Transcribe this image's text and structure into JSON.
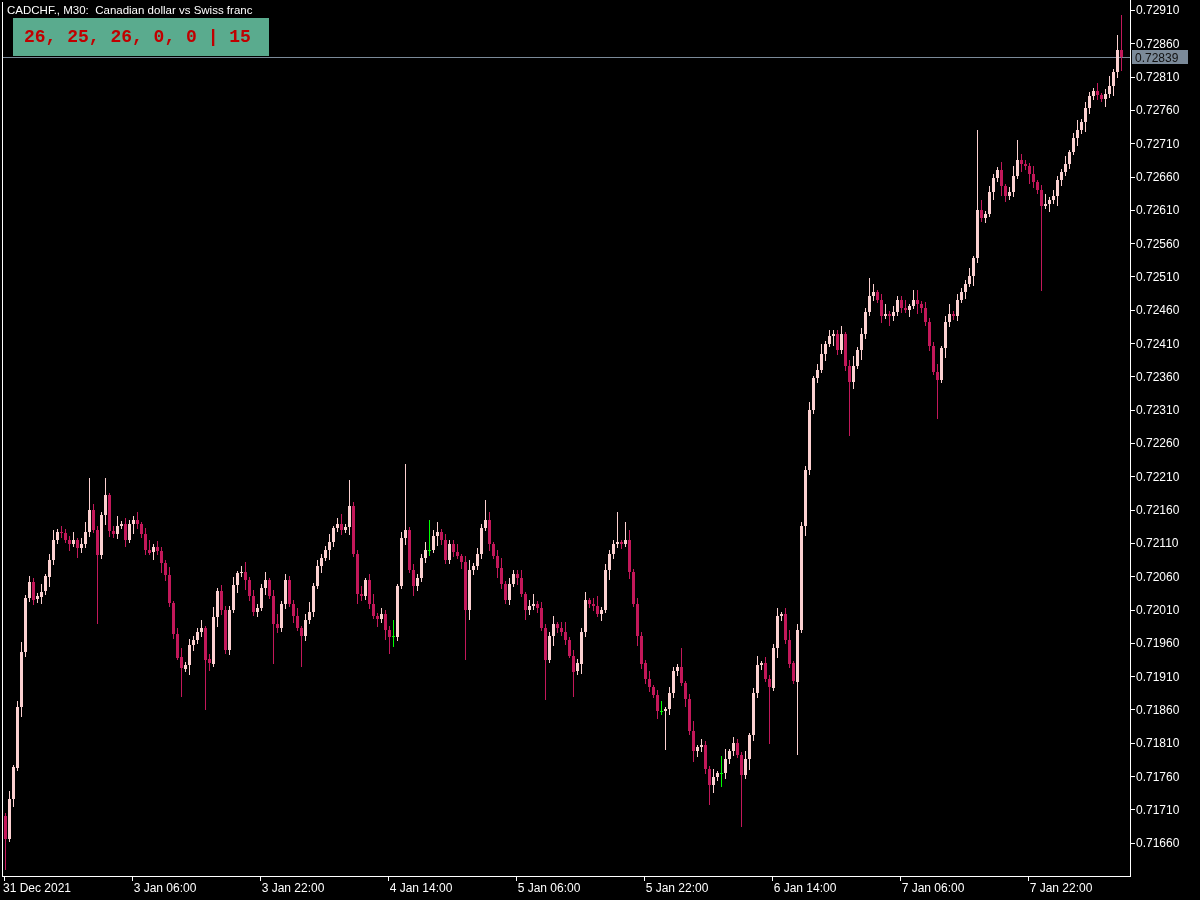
{
  "chart": {
    "chart_data": {
      "type": "candlestick",
      "title": "CADCHF., M30:  Canadian dollar vs Swiss franc",
      "categories": [
        null,
        null,
        null,
        null,
        null,
        null,
        null,
        null,
        "31 Dec 2021",
        null,
        null,
        null,
        null,
        null,
        null,
        null,
        null,
        null,
        null,
        null,
        null,
        null,
        null,
        null,
        null,
        null,
        null,
        null,
        null,
        null,
        null,
        null,
        null,
        null,
        null,
        null,
        null,
        null,
        null,
        null,
        "3 Jan 06:00",
        null,
        null,
        null,
        null,
        null,
        null,
        null,
        null,
        null,
        null,
        null,
        null,
        null,
        null,
        null,
        null,
        null,
        null,
        null,
        null,
        null,
        null,
        null,
        null,
        null,
        null,
        null,
        null,
        null,
        null,
        null,
        "3 Jan 22:00",
        null,
        null,
        null,
        null,
        null,
        null,
        null,
        null,
        null,
        null,
        null,
        null,
        null,
        null,
        null,
        null,
        null,
        null,
        null,
        null,
        null,
        null,
        null,
        null,
        null,
        null,
        null,
        null,
        null,
        null,
        null,
        "4 Jan 14:00",
        null,
        null,
        null,
        null,
        null,
        null,
        null,
        null,
        null,
        null,
        null,
        null,
        null,
        null,
        null,
        null,
        null,
        null,
        null,
        null,
        null,
        null,
        null,
        null,
        null,
        null,
        null,
        null,
        null,
        null,
        null,
        "5 Jan 06:00",
        null,
        null,
        null,
        null,
        null,
        null,
        null,
        null,
        null,
        null,
        null,
        null,
        null,
        null,
        null,
        null,
        null,
        null,
        null,
        null,
        null,
        null,
        null,
        null,
        null,
        null,
        null,
        null,
        null,
        null,
        null,
        "5 Jan 22:00",
        null,
        null,
        null,
        null,
        null,
        null,
        null,
        null,
        null,
        null,
        null,
        null,
        null,
        null,
        null,
        null,
        null,
        null,
        null,
        null,
        null,
        null,
        null,
        null,
        null,
        null,
        null,
        null,
        null,
        null,
        null,
        "6 Jan 14:00",
        null,
        null,
        null,
        null,
        null,
        null,
        null,
        null,
        null,
        null,
        null,
        null,
        null,
        null,
        null,
        null,
        null,
        null,
        null,
        null,
        null,
        null,
        null,
        null,
        null,
        null,
        null,
        null,
        null,
        null,
        null,
        "7 Jan 06:00",
        null,
        null,
        null,
        null,
        null,
        null,
        null,
        null,
        null,
        null,
        null,
        null,
        null,
        null,
        null,
        null,
        null,
        null,
        null,
        null,
        null,
        null,
        null,
        null,
        null,
        null,
        null,
        null,
        null,
        null,
        null,
        "7 Jan 22:00",
        null,
        null,
        null,
        null,
        null,
        null,
        null,
        null,
        null,
        null,
        null,
        null,
        null,
        null,
        null
      ],
      "ohlc": [
        [
          0.717,
          0.71705,
          0.7162,
          0.71665
        ],
        [
          0.71665,
          0.71737,
          0.71662,
          0.71725
        ],
        [
          0.71725,
          0.71776,
          0.71715,
          0.71773
        ],
        [
          0.71773,
          0.71872,
          0.71769,
          0.71864
        ],
        [
          0.71864,
          0.71962,
          0.7185,
          0.71947
        ],
        [
          0.71947,
          0.72032,
          0.7194,
          0.72028
        ],
        [
          0.72028,
          0.72061,
          0.72023,
          0.72052
        ],
        [
          0.72052,
          0.72058,
          0.72019,
          0.72025
        ],
        [
          0.72025,
          0.72035,
          0.72022,
          0.7203
        ],
        [
          0.7203,
          0.72049,
          0.7202,
          0.72037
        ],
        [
          0.72037,
          0.72063,
          0.72033,
          0.7206
        ],
        [
          0.7206,
          0.72093,
          0.72046,
          0.72085
        ],
        [
          0.72085,
          0.7213,
          0.72078,
          0.72115
        ],
        [
          0.72115,
          0.72131,
          0.7211,
          0.72127
        ],
        [
          0.72127,
          0.72136,
          0.72119,
          0.72125
        ],
        [
          0.72125,
          0.72131,
          0.72112,
          0.72115
        ],
        [
          0.72115,
          0.7212,
          0.72099,
          0.72109
        ],
        [
          0.72109,
          0.72127,
          0.72105,
          0.72115
        ],
        [
          0.72115,
          0.72118,
          0.72089,
          0.72103
        ],
        [
          0.72103,
          0.72117,
          0.72096,
          0.72109
        ],
        [
          0.72109,
          0.72142,
          0.72104,
          0.72127
        ],
        [
          0.72127,
          0.72208,
          0.72121,
          0.7216
        ],
        [
          0.7216,
          0.72169,
          0.72127,
          0.7213
        ],
        [
          0.7213,
          0.72136,
          0.7199,
          0.72092
        ],
        [
          0.72092,
          0.72157,
          0.72088,
          0.72152
        ],
        [
          0.72152,
          0.72208,
          0.72138,
          0.72182
        ],
        [
          0.72182,
          0.72185,
          0.72121,
          0.72128
        ],
        [
          0.72128,
          0.72136,
          0.72119,
          0.72124
        ],
        [
          0.72124,
          0.72151,
          0.72118,
          0.72136
        ],
        [
          0.72136,
          0.72143,
          0.72133,
          0.72139
        ],
        [
          0.72139,
          0.72148,
          0.72105,
          0.72115
        ],
        [
          0.72115,
          0.72145,
          0.72111,
          0.72139
        ],
        [
          0.72139,
          0.7215,
          0.72125,
          0.72145
        ],
        [
          0.72145,
          0.72157,
          0.72132,
          0.72139
        ],
        [
          0.72139,
          0.72142,
          0.72119,
          0.72124
        ],
        [
          0.72124,
          0.72132,
          0.72094,
          0.721
        ],
        [
          0.721,
          0.72115,
          0.72093,
          0.72096
        ],
        [
          0.72096,
          0.72108,
          0.72086,
          0.72104
        ],
        [
          0.72104,
          0.72113,
          0.72094,
          0.72098
        ],
        [
          0.72098,
          0.72104,
          0.72066,
          0.7208
        ],
        [
          0.7208,
          0.72085,
          0.72055,
          0.72062
        ],
        [
          0.72062,
          0.72074,
          0.72015,
          0.7202
        ],
        [
          0.7202,
          0.72023,
          0.71968,
          0.71974
        ],
        [
          0.71974,
          0.71982,
          0.71935,
          0.71938
        ],
        [
          0.71938,
          0.71953,
          0.7188,
          0.71921
        ],
        [
          0.71921,
          0.71931,
          0.71917,
          0.71927
        ],
        [
          0.71927,
          0.71966,
          0.71913,
          0.71957
        ],
        [
          0.71957,
          0.71971,
          0.7195,
          0.71965
        ],
        [
          0.71965,
          0.71982,
          0.7196,
          0.71977
        ],
        [
          0.71977,
          0.71995,
          0.71971,
          0.71983
        ],
        [
          0.71983,
          0.71986,
          0.7186,
          0.71935
        ],
        [
          0.71935,
          0.71943,
          0.71919,
          0.71929
        ],
        [
          0.71929,
          0.72014,
          0.71925,
          0.71999
        ],
        [
          0.71999,
          0.72042,
          0.71985,
          0.72038
        ],
        [
          0.72038,
          0.72047,
          0.72003,
          0.7201
        ],
        [
          0.7201,
          0.72016,
          0.71945,
          0.7195
        ],
        [
          0.7195,
          0.72015,
          0.71944,
          0.7201
        ],
        [
          0.7201,
          0.72059,
          0.72007,
          0.72047
        ],
        [
          0.72047,
          0.72068,
          0.72037,
          0.72065
        ],
        [
          0.72065,
          0.72075,
          0.72061,
          0.72067
        ],
        [
          0.72067,
          0.72082,
          0.72041,
          0.72055
        ],
        [
          0.72055,
          0.72059,
          0.72024,
          0.72031
        ],
        [
          0.72031,
          0.7204,
          0.72002,
          0.72007
        ],
        [
          0.72007,
          0.72019,
          0.72001,
          0.72013
        ],
        [
          0.72013,
          0.72048,
          0.7201,
          0.72043
        ],
        [
          0.72043,
          0.72067,
          0.72033,
          0.72055
        ],
        [
          0.72055,
          0.72058,
          0.72027,
          0.72031
        ],
        [
          0.72031,
          0.72039,
          0.7193,
          0.71989
        ],
        [
          0.71989,
          0.72004,
          0.71976,
          0.71983
        ],
        [
          0.71983,
          0.72023,
          0.71978,
          0.72019
        ],
        [
          0.72019,
          0.72064,
          0.72013,
          0.72055
        ],
        [
          0.72055,
          0.72061,
          0.72016,
          0.72019
        ],
        [
          0.72019,
          0.72024,
          0.71991,
          0.72001
        ],
        [
          0.72001,
          0.72013,
          0.71979,
          0.71983
        ],
        [
          0.71983,
          0.71986,
          0.71925,
          0.71971
        ],
        [
          0.71971,
          0.72003,
          0.71964,
          0.71995
        ],
        [
          0.71995,
          0.72022,
          0.7199,
          0.72007
        ],
        [
          0.72007,
          0.7205,
          0.72001,
          0.72046
        ],
        [
          0.72046,
          0.72085,
          0.72043,
          0.72076
        ],
        [
          0.72076,
          0.72094,
          0.72066,
          0.72088
        ],
        [
          0.72088,
          0.72105,
          0.72084,
          0.721
        ],
        [
          0.721,
          0.72124,
          0.72086,
          0.72112
        ],
        [
          0.72112,
          0.72136,
          0.72105,
          0.72133
        ],
        [
          0.72133,
          0.72147,
          0.72128,
          0.72139
        ],
        [
          0.72139,
          0.72154,
          0.72124,
          0.7213
        ],
        [
          0.7213,
          0.72138,
          0.72127,
          0.72134
        ],
        [
          0.72134,
          0.72205,
          0.72124,
          0.72166
        ],
        [
          0.72166,
          0.72172,
          0.7209,
          0.72094
        ],
        [
          0.72094,
          0.72099,
          0.7202,
          0.72034
        ],
        [
          0.72034,
          0.72046,
          0.72024,
          0.72031
        ],
        [
          0.72031,
          0.72058,
          0.72026,
          0.72055
        ],
        [
          0.72055,
          0.72063,
          0.72013,
          0.72019
        ],
        [
          0.72019,
          0.72034,
          0.71998,
          0.72001
        ],
        [
          0.72001,
          0.72005,
          0.71986,
          0.71996
        ],
        [
          0.71996,
          0.72013,
          0.71992,
          0.72004
        ],
        [
          0.72004,
          0.7201,
          0.71966,
          0.7198
        ],
        [
          0.7198,
          0.71985,
          0.71945,
          0.7197
        ],
        [
          0.7197,
          0.71995,
          0.71955,
          0.7197
        ],
        [
          0.7197,
          0.72049,
          0.71964,
          0.72046
        ],
        [
          0.72046,
          0.72126,
          0.72043,
          0.72118
        ],
        [
          0.72118,
          0.72228,
          0.72108,
          0.7213
        ],
        [
          0.7213,
          0.72134,
          0.72066,
          0.7207
        ],
        [
          0.7207,
          0.72079,
          0.72032,
          0.72046
        ],
        [
          0.72046,
          0.72064,
          0.72039,
          0.72058
        ],
        [
          0.72058,
          0.72093,
          0.72053,
          0.72088
        ],
        [
          0.72088,
          0.72112,
          0.72082,
          0.721
        ],
        [
          0.721,
          0.72145,
          0.72092,
          0.721
        ],
        [
          0.721,
          0.72129,
          0.72096,
          0.72121
        ],
        [
          0.72121,
          0.72142,
          0.72107,
          0.72127
        ],
        [
          0.72127,
          0.72131,
          0.72108,
          0.72115
        ],
        [
          0.72115,
          0.72124,
          0.7208,
          0.72085
        ],
        [
          0.72085,
          0.72115,
          0.7208,
          0.72109
        ],
        [
          0.72109,
          0.72114,
          0.72091,
          0.72097
        ],
        [
          0.72097,
          0.72109,
          0.72088,
          0.72091
        ],
        [
          0.72091,
          0.72094,
          0.72072,
          0.72082
        ],
        [
          0.72082,
          0.7209,
          0.71935,
          0.7201
        ],
        [
          0.7201,
          0.72085,
          0.71996,
          0.7207
        ],
        [
          0.7207,
          0.7208,
          0.72063,
          0.72076
        ],
        [
          0.72076,
          0.72103,
          0.72071,
          0.72094
        ],
        [
          0.72094,
          0.72139,
          0.72088,
          0.72133
        ],
        [
          0.72133,
          0.72175,
          0.7213,
          0.72145
        ],
        [
          0.72145,
          0.72157,
          0.72099,
          0.72109
        ],
        [
          0.72109,
          0.72112,
          0.72087,
          0.72091
        ],
        [
          0.72091,
          0.72099,
          0.72059,
          0.72073
        ],
        [
          0.72073,
          0.72088,
          0.72042,
          0.72049
        ],
        [
          0.72049,
          0.72053,
          0.7202,
          0.72025
        ],
        [
          0.72025,
          0.72058,
          0.72019,
          0.72049
        ],
        [
          0.72049,
          0.7207,
          0.72046,
          0.72064
        ],
        [
          0.72064,
          0.72069,
          0.72048,
          0.72058
        ],
        [
          0.72058,
          0.7207,
          0.7203,
          0.72034
        ],
        [
          0.72034,
          0.72037,
          0.71996,
          0.7201
        ],
        [
          0.7201,
          0.72024,
          0.72003,
          0.72016
        ],
        [
          0.72016,
          0.72034,
          0.72011,
          0.72019
        ],
        [
          0.72019,
          0.72023,
          0.72007,
          0.72013
        ],
        [
          0.72013,
          0.72022,
          0.7198,
          0.71983
        ],
        [
          0.71983,
          0.71989,
          0.71875,
          0.71935
        ],
        [
          0.71935,
          0.71976,
          0.71931,
          0.71971
        ],
        [
          0.71971,
          0.72001,
          0.71957,
          0.71989
        ],
        [
          0.71989,
          0.71992,
          0.71976,
          0.71983
        ],
        [
          0.71983,
          0.71991,
          0.71972,
          0.71977
        ],
        [
          0.71977,
          0.71992,
          0.71959,
          0.71965
        ],
        [
          0.71965,
          0.71969,
          0.71938,
          0.71941
        ],
        [
          0.71941,
          0.7195,
          0.7188,
          0.71917
        ],
        [
          0.71917,
          0.71935,
          0.71913,
          0.71929
        ],
        [
          0.71929,
          0.71982,
          0.71915,
          0.71977
        ],
        [
          0.71977,
          0.72037,
          0.7197,
          0.72025
        ],
        [
          0.72025,
          0.72028,
          0.72014,
          0.72019
        ],
        [
          0.72019,
          0.72027,
          0.7201,
          0.72016
        ],
        [
          0.72016,
          0.72031,
          0.72001,
          0.72004
        ],
        [
          0.72004,
          0.72014,
          0.71994,
          0.7201
        ],
        [
          0.7201,
          0.72079,
          0.72006,
          0.7207
        ],
        [
          0.7207,
          0.721,
          0.72056,
          0.72094
        ],
        [
          0.72094,
          0.72114,
          0.72087,
          0.72109
        ],
        [
          0.72109,
          0.72157,
          0.72104,
          0.72112
        ],
        [
          0.72112,
          0.72115,
          0.72103,
          0.72109
        ],
        [
          0.72109,
          0.72142,
          0.72106,
          0.72115
        ],
        [
          0.72115,
          0.7213,
          0.72057,
          0.72067
        ],
        [
          0.72067,
          0.72071,
          0.72015,
          0.72019
        ],
        [
          0.72019,
          0.72028,
          0.71957,
          0.71971
        ],
        [
          0.71971,
          0.71977,
          0.71922,
          0.71929
        ],
        [
          0.71929,
          0.71934,
          0.719,
          0.71905
        ],
        [
          0.71905,
          0.71917,
          0.71887,
          0.71893
        ],
        [
          0.71893,
          0.71896,
          0.71878,
          0.71881
        ],
        [
          0.71881,
          0.71889,
          0.71847,
          0.71857
        ],
        [
          0.71857,
          0.71872,
          0.71853,
          0.71857
        ],
        [
          0.71857,
          0.71864,
          0.718,
          0.7186
        ],
        [
          0.7186,
          0.71893,
          0.71853,
          0.71884
        ],
        [
          0.71884,
          0.71923,
          0.71879,
          0.71917
        ],
        [
          0.71917,
          0.71928,
          0.71911,
          0.71923
        ],
        [
          0.71923,
          0.71953,
          0.71896,
          0.71899
        ],
        [
          0.71899,
          0.71902,
          0.71865,
          0.71875
        ],
        [
          0.71875,
          0.71883,
          0.71823,
          0.71827
        ],
        [
          0.71827,
          0.71842,
          0.71783,
          0.71797
        ],
        [
          0.71797,
          0.71807,
          0.7179,
          0.71803
        ],
        [
          0.71803,
          0.71815,
          0.71798,
          0.71806
        ],
        [
          0.71806,
          0.71812,
          0.71764,
          0.7177
        ],
        [
          0.7177,
          0.71775,
          0.71718,
          0.71746
        ],
        [
          0.71746,
          0.7177,
          0.71736,
          0.71758
        ],
        [
          0.71758,
          0.71767,
          0.71754,
          0.71764
        ],
        [
          0.71764,
          0.7179,
          0.71745,
          0.71764
        ],
        [
          0.71764,
          0.718,
          0.71757,
          0.71785
        ],
        [
          0.71785,
          0.71801,
          0.7178,
          0.71797
        ],
        [
          0.71797,
          0.71818,
          0.71791,
          0.71809
        ],
        [
          0.71809,
          0.71815,
          0.71788,
          0.71791
        ],
        [
          0.71791,
          0.71796,
          0.71685,
          0.71761
        ],
        [
          0.71761,
          0.71797,
          0.71757,
          0.71785
        ],
        [
          0.71785,
          0.71824,
          0.71771,
          0.71821
        ],
        [
          0.71821,
          0.71892,
          0.71814,
          0.71884
        ],
        [
          0.71884,
          0.71941,
          0.71879,
          0.71926
        ],
        [
          0.71926,
          0.71933,
          0.7192,
          0.71929
        ],
        [
          0.71929,
          0.71938,
          0.71902,
          0.71905
        ],
        [
          0.71905,
          0.71911,
          0.7181,
          0.71893
        ],
        [
          0.71893,
          0.71958,
          0.71889,
          0.71953
        ],
        [
          0.71953,
          0.72013,
          0.71939,
          0.72001
        ],
        [
          0.72001,
          0.72007,
          0.71994,
          0.72004
        ],
        [
          0.72004,
          0.72012,
          0.7196,
          0.71965
        ],
        [
          0.71965,
          0.7198,
          0.71923,
          0.71929
        ],
        [
          0.71929,
          0.71933,
          0.71899,
          0.71902
        ],
        [
          0.71902,
          0.71989,
          0.71793,
          0.7198
        ],
        [
          0.7198,
          0.72142,
          0.71976,
          0.72136
        ],
        [
          0.72136,
          0.72225,
          0.72122,
          0.7222
        ],
        [
          0.7222,
          0.72322,
          0.72213,
          0.7231
        ],
        [
          0.7231,
          0.72361,
          0.72305,
          0.72358
        ],
        [
          0.72358,
          0.72378,
          0.72352,
          0.7237
        ],
        [
          0.7237,
          0.72409,
          0.72367,
          0.72394
        ],
        [
          0.72394,
          0.72413,
          0.72384,
          0.72409
        ],
        [
          0.72409,
          0.7243,
          0.72405,
          0.72421
        ],
        [
          0.72421,
          0.7243,
          0.72407,
          0.72424
        ],
        [
          0.72424,
          0.72429,
          0.72393,
          0.724
        ],
        [
          0.724,
          0.72436,
          0.72395,
          0.72424
        ],
        [
          0.72424,
          0.72427,
          0.7237,
          0.72376
        ],
        [
          0.72376,
          0.72384,
          0.72272,
          0.72352
        ],
        [
          0.72352,
          0.72391,
          0.72342,
          0.72376
        ],
        [
          0.72376,
          0.72404,
          0.72372,
          0.724
        ],
        [
          0.724,
          0.72433,
          0.72386,
          0.72424
        ],
        [
          0.72424,
          0.72463,
          0.72417,
          0.72457
        ],
        [
          0.72457,
          0.72508,
          0.72452,
          0.72481
        ],
        [
          0.72481,
          0.72499,
          0.72475,
          0.72487
        ],
        [
          0.72487,
          0.7249,
          0.72472,
          0.72475
        ],
        [
          0.72475,
          0.72483,
          0.72441,
          0.72451
        ],
        [
          0.72451,
          0.72469,
          0.72447,
          0.72454
        ],
        [
          0.72454,
          0.72458,
          0.72437,
          0.72451
        ],
        [
          0.72451,
          0.72466,
          0.72444,
          0.72457
        ],
        [
          0.72457,
          0.72481,
          0.72452,
          0.72475
        ],
        [
          0.72475,
          0.7248,
          0.72457,
          0.72463
        ],
        [
          0.72463,
          0.72475,
          0.72457,
          0.7246
        ],
        [
          0.7246,
          0.72469,
          0.7245,
          0.72466
        ],
        [
          0.72466,
          0.7249,
          0.72462,
          0.72475
        ],
        [
          0.72475,
          0.7249,
          0.72455,
          0.72469
        ],
        [
          0.72469,
          0.72473,
          0.72456,
          0.72463
        ],
        [
          0.72463,
          0.72472,
          0.72437,
          0.72442
        ],
        [
          0.72442,
          0.72448,
          0.724,
          0.72406
        ],
        [
          0.72406,
          0.72411,
          0.72364,
          0.72367
        ],
        [
          0.72367,
          0.72379,
          0.72298,
          0.72355
        ],
        [
          0.72355,
          0.72406,
          0.72351,
          0.72403
        ],
        [
          0.72403,
          0.7245,
          0.72389,
          0.72442
        ],
        [
          0.72442,
          0.72469,
          0.72435,
          0.72454
        ],
        [
          0.72454,
          0.72458,
          0.72446,
          0.72451
        ],
        [
          0.72451,
          0.72484,
          0.72445,
          0.72475
        ],
        [
          0.72475,
          0.72493,
          0.72472,
          0.72487
        ],
        [
          0.72487,
          0.72504,
          0.72477,
          0.72499
        ],
        [
          0.72499,
          0.72523,
          0.72495,
          0.72511
        ],
        [
          0.72511,
          0.72541,
          0.72497,
          0.72538
        ],
        [
          0.72538,
          0.7273,
          0.72531,
          0.7261
        ],
        [
          0.7261,
          0.72625,
          0.72593,
          0.72598
        ],
        [
          0.72598,
          0.72608,
          0.72592,
          0.72604
        ],
        [
          0.72604,
          0.72646,
          0.72601,
          0.72637
        ],
        [
          0.72637,
          0.72664,
          0.72627,
          0.72658
        ],
        [
          0.72658,
          0.72675,
          0.72654,
          0.7267
        ],
        [
          0.7267,
          0.72682,
          0.72632,
          0.72646
        ],
        [
          0.72646,
          0.72649,
          0.72624,
          0.72631
        ],
        [
          0.72631,
          0.72645,
          0.72626,
          0.72637
        ],
        [
          0.72637,
          0.72676,
          0.72631,
          0.72661
        ],
        [
          0.72661,
          0.72715,
          0.72658,
          0.72685
        ],
        [
          0.72685,
          0.72694,
          0.72669,
          0.72679
        ],
        [
          0.72679,
          0.72685,
          0.72672,
          0.72676
        ],
        [
          0.72676,
          0.72681,
          0.7265,
          0.72664
        ],
        [
          0.72664,
          0.72676,
          0.72645,
          0.72652
        ],
        [
          0.72652,
          0.72655,
          0.72635,
          0.7264
        ],
        [
          0.7264,
          0.72648,
          0.7249,
          0.72616
        ],
        [
          0.72616,
          0.72634,
          0.72613,
          0.72619
        ],
        [
          0.72619,
          0.72629,
          0.72609,
          0.72625
        ],
        [
          0.72625,
          0.7264,
          0.72621,
          0.72631
        ],
        [
          0.72631,
          0.72661,
          0.72617,
          0.72655
        ],
        [
          0.72655,
          0.72672,
          0.72648,
          0.72667
        ],
        [
          0.72667,
          0.72691,
          0.72662,
          0.72679
        ],
        [
          0.72679,
          0.727,
          0.72673,
          0.72697
        ],
        [
          0.72697,
          0.72726,
          0.72694,
          0.72718
        ],
        [
          0.72718,
          0.72745,
          0.72708,
          0.7273
        ],
        [
          0.7273,
          0.72746,
          0.72726,
          0.72742
        ],
        [
          0.72742,
          0.72772,
          0.72728,
          0.72763
        ],
        [
          0.72763,
          0.72787,
          0.72756,
          0.72781
        ],
        [
          0.72781,
          0.72793,
          0.72776,
          0.72788
        ],
        [
          0.72788,
          0.728,
          0.72776,
          0.72782
        ],
        [
          0.72782,
          0.72785,
          0.72773,
          0.72776
        ],
        [
          0.72776,
          0.72792,
          0.72766,
          0.72784
        ],
        [
          0.72784,
          0.72811,
          0.7278,
          0.72796
        ],
        [
          0.72796,
          0.72821,
          0.72782,
          0.72817
        ],
        [
          0.72817,
          0.72872,
          0.7281,
          0.7285
        ],
        [
          0.7285,
          0.72903,
          0.7282,
          0.72839
        ]
      ],
      "ylim": [
        0.7161,
        0.72922
      ],
      "yticks": [
        {
          "value": 0.7291,
          "label": "0.72910"
        },
        {
          "value": 0.7286,
          "label": "0.72860"
        },
        {
          "value": 0.7281,
          "label": "0.72810"
        },
        {
          "value": 0.7276,
          "label": "0.72760"
        },
        {
          "value": 0.7271,
          "label": "0.72710"
        },
        {
          "value": 0.7266,
          "label": "0.72660"
        },
        {
          "value": 0.7261,
          "label": "0.72610"
        },
        {
          "value": 0.7256,
          "label": "0.72560"
        },
        {
          "value": 0.7251,
          "label": "0.72510"
        },
        {
          "value": 0.7246,
          "label": "0.72460"
        },
        {
          "value": 0.7241,
          "label": "0.72410"
        },
        {
          "value": 0.7236,
          "label": "0.72360"
        },
        {
          "value": 0.7231,
          "label": "0.72310"
        },
        {
          "value": 0.7226,
          "label": "0.72260"
        },
        {
          "value": 0.7221,
          "label": "0.72210"
        },
        {
          "value": 0.7216,
          "label": "0.72160"
        },
        {
          "value": 0.7211,
          "label": "0.72110"
        },
        {
          "value": 0.7206,
          "label": "0.72060"
        },
        {
          "value": 0.7201,
          "label": "0.72010"
        },
        {
          "value": 0.7196,
          "label": "0.71960"
        },
        {
          "value": 0.7191,
          "label": "0.71910"
        },
        {
          "value": 0.7186,
          "label": "0.71860"
        },
        {
          "value": 0.7181,
          "label": "0.71810"
        },
        {
          "value": 0.7176,
          "label": "0.71760"
        },
        {
          "value": 0.7171,
          "label": "0.71710"
        },
        {
          "value": 0.7166,
          "label": "0.71660"
        }
      ],
      "ref_lines": [
        {
          "axis": "y",
          "value": 0.72839,
          "label": "0.72839"
        }
      ]
    }
  },
  "indicator": {
    "text": "26, 25, 26, 0, 0 | 15"
  }
}
